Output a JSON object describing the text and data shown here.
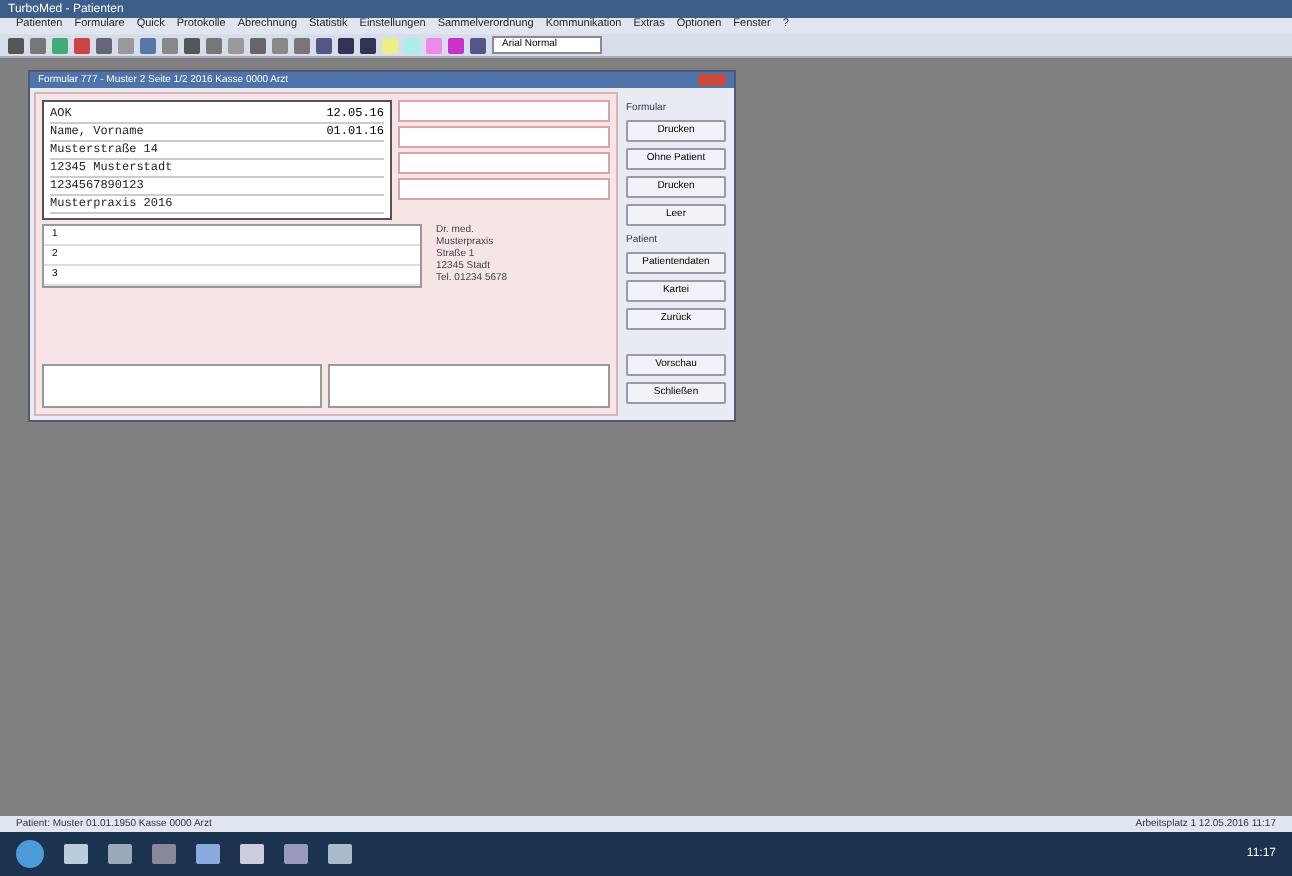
{
  "window": {
    "title": "TurboMed - Patienten"
  },
  "menu": [
    "Patienten",
    "Formulare",
    "Quick",
    "Protokolle",
    "Abrechnung",
    "Statistik",
    "Einstellungen",
    "Sammelverordnung",
    "Kommunikation",
    "Extras",
    "Optionen",
    "Fenster",
    "?"
  ],
  "toolbar": {
    "combo_value": "Arial Normal"
  },
  "form_window": {
    "title": "Formular 777 - Muster 2 Seite 1/2 2016 Kasse 0000 Arzt",
    "insurance_fields": [
      "AOK",
      "Name, Vorname",
      "Musterstraße 14",
      "12345 Musterstadt",
      "1234567890123",
      "Musterpraxis 2016"
    ],
    "dates": [
      "12.05.16",
      "01.01.16"
    ],
    "diagnosis_lines": [
      "1",
      "2",
      "3"
    ],
    "stamp_lines": [
      "Dr. med.",
      "Musterpraxis",
      "Straße 1",
      "12345 Stadt",
      "Tel. 01234 5678"
    ],
    "button_groups": [
      {
        "label": "Formular",
        "buttons": [
          "Drucken",
          "Ohne Patient",
          "Drucken",
          "Leer"
        ]
      },
      {
        "label": "Patient",
        "buttons": [
          "Patientendaten",
          "Kartei",
          "Zurück"
        ]
      },
      {
        "buttons": [
          "Vorschau",
          "Schließen"
        ]
      }
    ]
  },
  "status_bar": {
    "left": "Patient: Muster 01.01.1950 Kasse 0000 Arzt",
    "right": "Arbeitsplatz 1 12.05.2016 11:17"
  },
  "taskbar": {
    "time": "11:17"
  }
}
